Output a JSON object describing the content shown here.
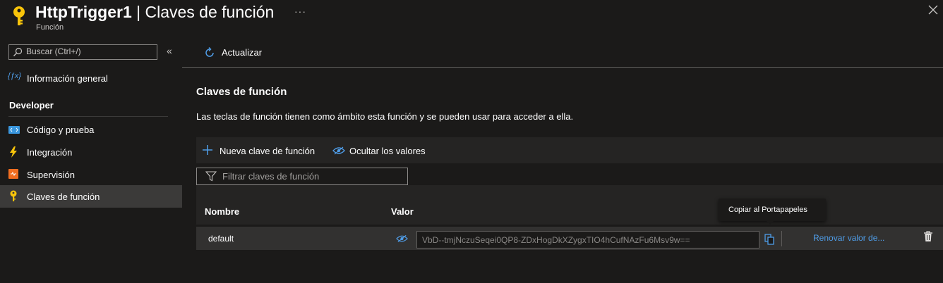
{
  "header": {
    "title_bold": "HttpTrigger1",
    "title_rest": " | Claves de función",
    "subtitle": "Función",
    "more": "···"
  },
  "sidebar": {
    "search_placeholder": "Buscar (Ctrl+/)",
    "collapse": "«",
    "overview": "Información general",
    "section": "Developer",
    "items": [
      {
        "label": "Código y prueba",
        "icon": "code-icon"
      },
      {
        "label": "Integración",
        "icon": "lightning-icon"
      },
      {
        "label": "Supervisión",
        "icon": "monitor-icon"
      },
      {
        "label": "Claves de función",
        "icon": "key-icon",
        "active": true
      }
    ]
  },
  "toolbar": {
    "refresh_label": "Actualizar"
  },
  "main": {
    "heading": "Claves de función",
    "description": "Las teclas de función tienen como ámbito esta función y se pueden usar para acceder a ella.",
    "new_key_label": "Nueva clave de función",
    "hide_values_label": "Ocultar los valores",
    "filter_placeholder": "Filtrar claves de función",
    "table": {
      "columns": [
        "Nombre",
        "Valor"
      ],
      "rows": [
        {
          "name": "default",
          "value": "VbD--tmjNczuSeqei0QP8-ZDxHogDkXZygxTIO4hCufNAzFu6Msv9w==",
          "renew_label": "Renovar valor de..."
        }
      ]
    },
    "tooltip": "Copiar al Portapapeles"
  },
  "colors": {
    "background": "#1b1a19",
    "accent": "#4f9de8",
    "key_gold": "#f8c40a",
    "row_bg": "#323130"
  }
}
